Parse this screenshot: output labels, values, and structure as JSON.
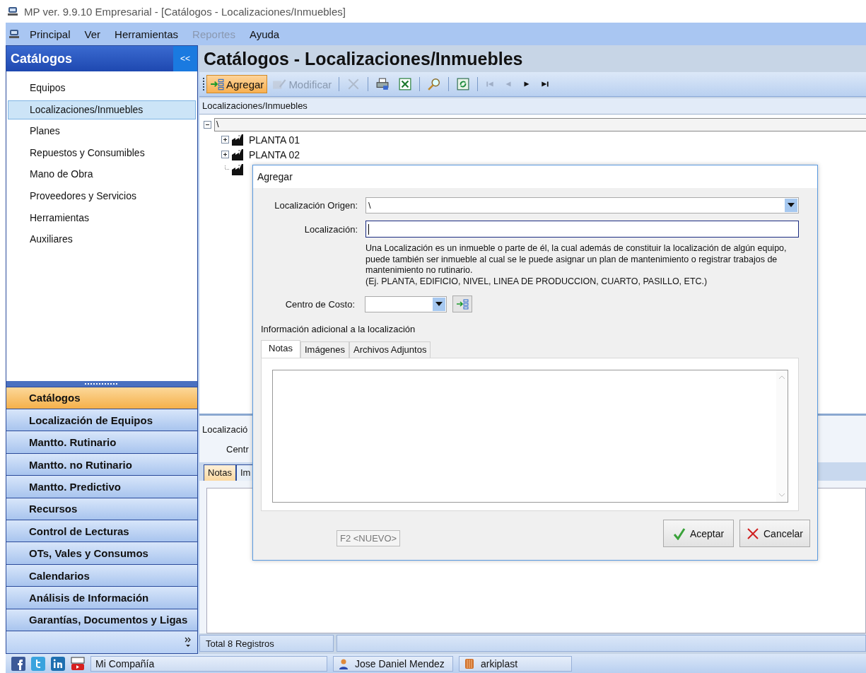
{
  "window": {
    "title": "MP ver. 9.9.10 Empresarial - [Catálogos - Localizaciones/Inmuebles]"
  },
  "menu": [
    {
      "label": "Principal",
      "disabled": false
    },
    {
      "label": "Ver",
      "disabled": false
    },
    {
      "label": "Herramientas",
      "disabled": false
    },
    {
      "label": "Reportes",
      "disabled": true
    },
    {
      "label": "Ayuda",
      "disabled": false
    }
  ],
  "sidebar": {
    "title": "Catálogos",
    "collapse": "<<",
    "items": [
      {
        "label": "Equipos",
        "selected": false
      },
      {
        "label": "Localizaciones/Inmuebles",
        "selected": true
      },
      {
        "label": "Planes",
        "selected": false
      },
      {
        "label": "Repuestos y Consumibles",
        "selected": false
      },
      {
        "label": "Mano de Obra",
        "selected": false
      },
      {
        "label": "Proveedores y Servicios",
        "selected": false
      },
      {
        "label": "Herramientas",
        "selected": false
      },
      {
        "label": "Auxiliares",
        "selected": false
      }
    ],
    "sections": [
      {
        "label": "Catálogos",
        "selected": true
      },
      {
        "label": "Localización de Equipos",
        "selected": false
      },
      {
        "label": "Mantto. Rutinario",
        "selected": false
      },
      {
        "label": "Mantto. no Rutinario",
        "selected": false
      },
      {
        "label": "Mantto. Predictivo",
        "selected": false
      },
      {
        "label": "Recursos",
        "selected": false
      },
      {
        "label": "Control de Lecturas",
        "selected": false
      },
      {
        "label": "OTs, Vales y Consumos",
        "selected": false
      },
      {
        "label": "Calendarios",
        "selected": false
      },
      {
        "label": "Análisis de Información",
        "selected": false
      },
      {
        "label": "Garantías, Documentos y Ligas",
        "selected": false
      }
    ]
  },
  "page": {
    "title": "Catálogos - Localizaciones/Inmuebles"
  },
  "toolbar": [
    {
      "kind": "add",
      "label": "Agregar",
      "disabled": false,
      "highlighted": true
    },
    {
      "kind": "edit",
      "label": "Modificar",
      "disabled": true,
      "highlighted": false
    },
    {
      "kind": "delete",
      "disabled": true,
      "highlighted": false
    },
    {
      "kind": "print",
      "disabled": false,
      "highlighted": false
    },
    {
      "kind": "excel",
      "disabled": false,
      "highlighted": false
    },
    {
      "kind": "search",
      "disabled": false,
      "highlighted": false
    },
    {
      "kind": "refresh",
      "disabled": false,
      "highlighted": false
    },
    {
      "kind": "first",
      "disabled": true,
      "highlighted": false
    },
    {
      "kind": "prev",
      "disabled": true,
      "highlighted": false
    },
    {
      "kind": "next",
      "disabled": false,
      "highlighted": false
    },
    {
      "kind": "last",
      "disabled": false,
      "highlighted": false
    }
  ],
  "tree": {
    "header": "Localizaciones/Inmuebles",
    "root": {
      "label": "\\",
      "expanded": true,
      "children": [
        {
          "label": "PLANTA 01",
          "expandable": true
        },
        {
          "label": "PLANTA 02",
          "expandable": true
        },
        {
          "expandable": false
        }
      ]
    }
  },
  "detail": {
    "fields": [
      "Localizació",
      "Centr"
    ],
    "tabs": [
      {
        "label": "Notas",
        "selected": true
      },
      {
        "label": "Im",
        "selected": false
      }
    ]
  },
  "status_bar": {
    "count": "Total 8 Registros"
  },
  "taskbar": {
    "company": "Mi Compañía",
    "user": "Jose Daniel Mendez",
    "database": "arkiplast"
  },
  "dialog": {
    "title": "Agregar",
    "origin": {
      "label": "Localización Origen:",
      "value": "\\"
    },
    "location": {
      "label": "Localización:"
    },
    "help": "Una Localización es un inmueble o parte de él, la cual además de constituir la localización de algún equipo, puede también ser inmueble al cual se le puede asignar un plan de mantenimiento o registrar trabajos de mantenimiento no rutinario.",
    "example": "(Ej. PLANTA, EDIFICIO, NIVEL, LINEA DE PRODUCCION, CUARTO, PASILLO, ETC.)",
    "cost_center": {
      "label": "Centro de Costo:"
    },
    "extra_title": "Información adicional a la localización",
    "tabs": [
      {
        "label": "Notas",
        "selected": true
      },
      {
        "label": "Imágenes",
        "selected": false
      },
      {
        "label": "Archivos Adjuntos",
        "selected": false
      }
    ],
    "hint": "F2 <NUEVO>",
    "buttons": [
      {
        "kind": "ok",
        "label": "Aceptar"
      },
      {
        "kind": "cancel",
        "label": "Cancelar"
      }
    ]
  }
}
